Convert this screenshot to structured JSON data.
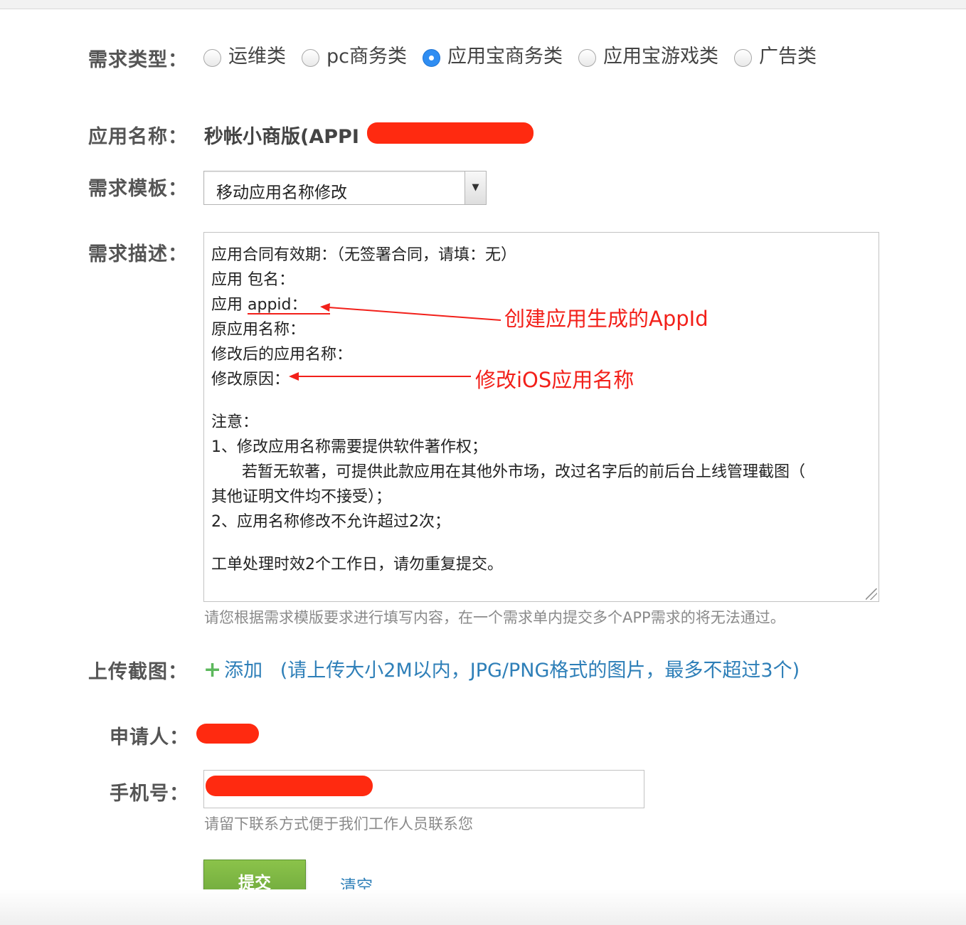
{
  "labels": {
    "type": "需求类型：",
    "app_name": "应用名称：",
    "template": "需求模板：",
    "description": "需求描述：",
    "upload": "上传截图：",
    "applicant": "申请人：",
    "phone": "手机号："
  },
  "radio_options": [
    {
      "label": "运维类",
      "checked": false
    },
    {
      "label": "pc商务类",
      "checked": false
    },
    {
      "label": "应用宝商务类",
      "checked": true
    },
    {
      "label": "应用宝游戏类",
      "checked": false
    },
    {
      "label": "广告类",
      "checked": false
    }
  ],
  "app_name_value": "秒帐小商版(APPI",
  "template_select": {
    "value": "移动应用名称修改"
  },
  "description_lines": [
    "应用合同有效期：（无签署合同，请填：无）",
    "应用 包名：",
    "应用 appid：",
    "原应用名称：",
    "修改后的应用名称：",
    "修改原因：",
    "注意：",
    "1、修改应用名称需要提供软件著作权；",
    "若暂无软著，可提供此款应用在其他外市场，改过名字后的前后台上线管理截图（",
    "其他证明文件均不接受）；",
    "2、应用名称修改不允许超过2次；",
    "工单处理时效2个工作日，请勿重复提交。"
  ],
  "description_hint": "请您根据需求模版要求进行填写内容，在一个需求单内提交多个APP需求的将无法通过。",
  "upload": {
    "add_label": "添加",
    "hint": "(请上传大小2M以内，JPG/PNG格式的图片，最多不超过3个)"
  },
  "phone_hint": "请留下联系方式便于我们工作人员联系您",
  "buttons": {
    "submit": "提交",
    "clear": "清空"
  },
  "annotations": {
    "appid_note": "创建应用生成的AppId",
    "reason_note": "修改iOS应用名称"
  },
  "colors": {
    "annotation_red": "#f2201a",
    "redaction_red": "#ff2a10",
    "radio_checked": "#2f8df2",
    "submit_green": "#7ab743",
    "link_blue": "#2e7fb8"
  }
}
